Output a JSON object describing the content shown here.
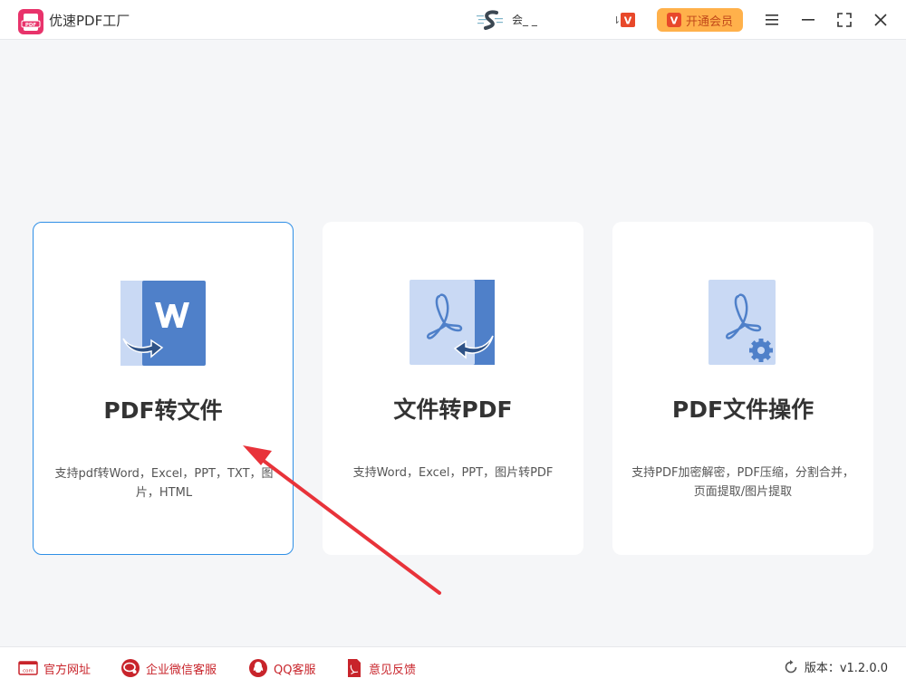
{
  "app": {
    "title": "优速PDF工厂",
    "logo_text": "PDF"
  },
  "user": {
    "name": "会_ _",
    "vip_badge": "V"
  },
  "vip_button": {
    "label": "开通会员",
    "icon_text": "V"
  },
  "cards": [
    {
      "title": "PDF转文件",
      "desc": "支持pdf转Word，Excel，PPT，TXT，图片，HTML",
      "icon": "word-convert-icon"
    },
    {
      "title": "文件转PDF",
      "desc": "支持Word，Excel，PPT，图片转PDF",
      "icon": "pdf-convert-icon"
    },
    {
      "title": "PDF文件操作",
      "desc": "支持PDF加密解密，PDF压缩，分割合并，页面提取/图片提取",
      "icon": "pdf-settings-icon"
    }
  ],
  "footer": {
    "links": [
      {
        "label": "官方网址",
        "icon": "website-icon"
      },
      {
        "label": "企业微信客服",
        "icon": "wechat-work-icon"
      },
      {
        "label": "QQ客服",
        "icon": "qq-icon"
      },
      {
        "label": "意见反馈",
        "icon": "feedback-icon"
      }
    ],
    "version": "版本：v1.2.0.0"
  },
  "colors": {
    "accent": "#2f8fe6",
    "brand_red": "#c8242b",
    "vip": "#ffb14b",
    "icon_blue": "#4f80c9",
    "icon_light": "#c9d9f4"
  }
}
